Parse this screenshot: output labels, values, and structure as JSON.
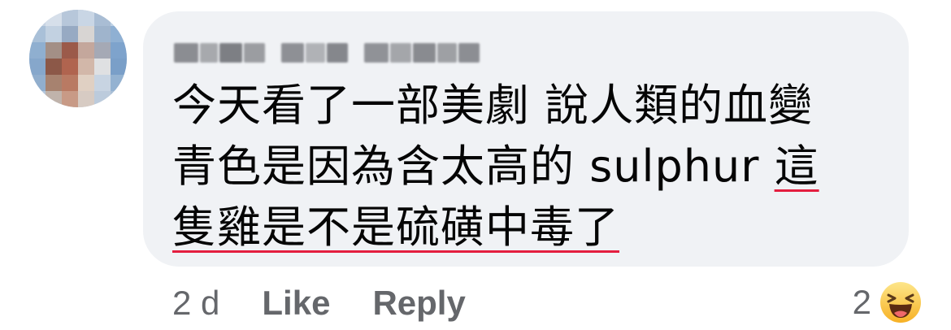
{
  "comment": {
    "author_name": "Ping Sue Chen",
    "text_lines": [
      "今天看了一部美劇 說人類的血變",
      "青色是因為含太高的 sulphur ",
      "隻雞是不是硫磺中毒了"
    ],
    "underlined_start": "這",
    "timestamp": "2 d",
    "like_label": "Like",
    "reply_label": "Reply",
    "reaction_count": "2",
    "reaction_icon": "haha-emoji-icon"
  },
  "colors": {
    "bubble": "#f0f2f5",
    "text": "#050505",
    "meta": "#65676b",
    "underline": "#e41e3f",
    "reaction": "#f7b125"
  }
}
